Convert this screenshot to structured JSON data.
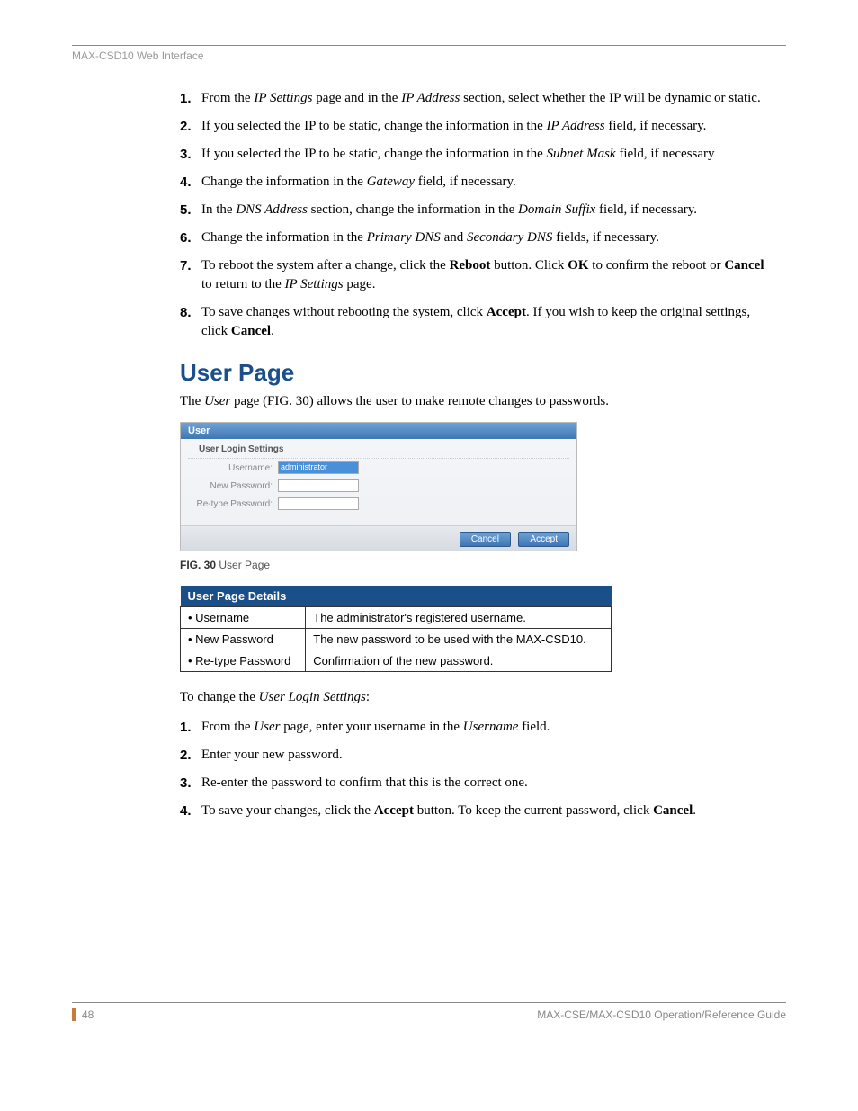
{
  "header": "MAX-CSD10 Web Interface",
  "steps_a": [
    {
      "n": "1.",
      "pre": "From the ",
      "i1": "IP Settings",
      "mid": " page and in the ",
      "i2": "IP Address",
      "post": " section, select whether the IP will be dynamic or static."
    },
    {
      "n": "2.",
      "pre": "If you selected the IP to be static, change the information in the ",
      "i1": "IP Address",
      "post": " field, if necessary."
    },
    {
      "n": "3.",
      "pre": "If you selected the IP to be static, change the information in the ",
      "i1": "Subnet Mask",
      "post": " field, if necessary"
    },
    {
      "n": "4.",
      "pre": "Change the information in the ",
      "i1": "Gateway",
      "post": " field, if necessary."
    },
    {
      "n": "5.",
      "pre": "In the ",
      "i1": "DNS Address",
      "mid": " section, change the information in the ",
      "i2": "Domain Suffix",
      "post": " field, if necessary."
    },
    {
      "n": "6.",
      "pre": "Change the information in the ",
      "i1": "Primary DNS",
      "mid": " and ",
      "i2": "Secondary DNS",
      "post": " fields, if necessary."
    }
  ],
  "step7": {
    "n": "7.",
    "t1": "To reboot the system after a change, click the ",
    "b1": "Reboot",
    "t2": " button. Click ",
    "b2": "OK",
    "t3": " to confirm the reboot or ",
    "b3": "Cancel",
    "t4": " to return to the ",
    "i1": "IP Settings",
    "t5": " page."
  },
  "step8": {
    "n": "8.",
    "t1": "To save changes without rebooting the system, click ",
    "b1": "Accept",
    "t2": ". If you wish to keep the original settings, click ",
    "b2": "Cancel",
    "t3": "."
  },
  "section_title": "User Page",
  "section_intro": {
    "t1": "The ",
    "i1": "User",
    "t2": " page (FIG. 30) allows the user to make remote changes to passwords."
  },
  "fig": {
    "titlebar": "User",
    "subhead": "User Login Settings",
    "rows": [
      {
        "label": "Username:",
        "value": "administrator",
        "sel": true
      },
      {
        "label": "New Password:",
        "value": "",
        "sel": false
      },
      {
        "label": "Re-type Password:",
        "value": "",
        "sel": false
      }
    ],
    "btn_cancel": "Cancel",
    "btn_accept": "Accept"
  },
  "fig_caption": {
    "b": "FIG. 30",
    "t": "  User Page"
  },
  "table": {
    "header": "User Page Details",
    "rows": [
      {
        "k": "• Username",
        "v": "The administrator's registered username."
      },
      {
        "k": "• New Password",
        "v": "The new password to be used with the MAX-CSD10."
      },
      {
        "k": "• Re-type Password",
        "v": "Confirmation of the new password."
      }
    ]
  },
  "change_intro": {
    "t1": "To change the ",
    "i1": "User Login Settings",
    "t2": ":"
  },
  "steps_b": [
    {
      "n": "1.",
      "t1": "From the ",
      "i1": "User",
      "t2": " page, enter your username in the ",
      "i2": "Username",
      "t3": " field."
    },
    {
      "n": "2.",
      "t1": "Enter your new password."
    },
    {
      "n": "3.",
      "t1": "Re-enter the password to confirm that this is the correct one."
    },
    {
      "n": "4.",
      "t1": "To save your changes, click the ",
      "b1": "Accept",
      "t2": " button. To keep the current password, click ",
      "b2": "Cancel",
      "t3": "."
    }
  ],
  "footer": {
    "page": "48",
    "guide": "MAX-CSE/MAX-CSD10 Operation/Reference Guide"
  }
}
